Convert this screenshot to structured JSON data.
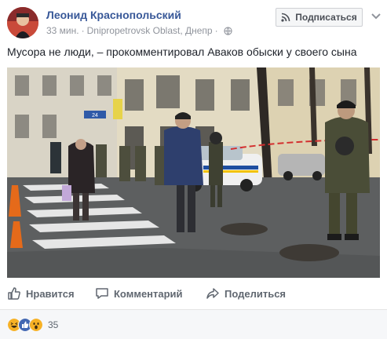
{
  "post": {
    "author": "Леонид Краснопольский",
    "time": "33 мин.",
    "separator": "·",
    "location": "Dnipropetrovsk Oblast, Днепр",
    "globe_icon": "globe-icon",
    "subscribe_label": "Подписаться",
    "text": "Мусора не люди, – прокомментировал Аваков обыски у своего сына"
  },
  "actions": {
    "like_label": "Нравится",
    "comment_label": "Комментарий",
    "share_label": "Поделиться"
  },
  "reactions": {
    "types": [
      "haha",
      "like",
      "wow"
    ],
    "count": "35"
  },
  "photo_signs": {
    "street_number": "24"
  },
  "colors": {
    "link_blue": "#385898",
    "like_blue": "#4267b2",
    "reaction_yellow": "#f7b125"
  }
}
